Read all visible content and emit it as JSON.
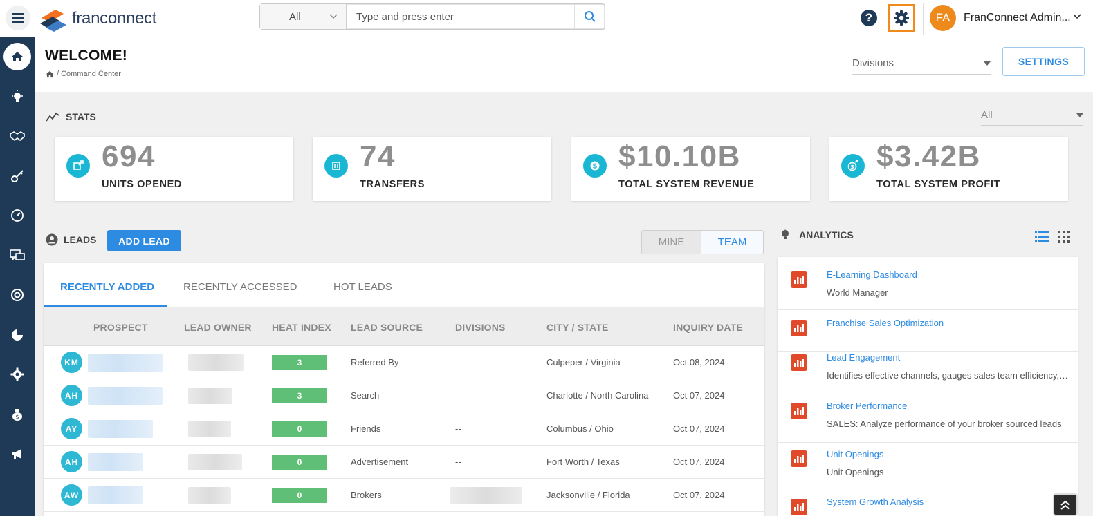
{
  "header": {
    "logo_text": "franconnect",
    "search_scope": "All",
    "search_placeholder": "Type and press enter",
    "user_initials": "FA",
    "user_name": "FranConnect Admin..."
  },
  "page": {
    "title": "WELCOME!",
    "breadcrumb": "/ Command Center",
    "divisions_label": "Divisions",
    "settings_label": "SETTINGS"
  },
  "stats": {
    "section_label": "STATS",
    "filter_value": "All",
    "cards": [
      {
        "value": "694",
        "label": "UNITS OPENED"
      },
      {
        "value": "74",
        "label": "TRANSFERS"
      },
      {
        "value": "$10.10B",
        "label": "TOTAL SYSTEM REVENUE"
      },
      {
        "value": "$3.42B",
        "label": "TOTAL SYSTEM PROFIT"
      }
    ]
  },
  "leads": {
    "section_label": "LEADS",
    "add_label": "ADD LEAD",
    "toggle_mine": "MINE",
    "toggle_team": "TEAM",
    "tabs": [
      "RECENTLY ADDED",
      "RECENTLY ACCESSED",
      "HOT LEADS"
    ],
    "columns": [
      "PROSPECT",
      "LEAD OWNER",
      "HEAT INDEX",
      "LEAD SOURCE",
      "DIVISIONS",
      "CITY / STATE",
      "INQUIRY DATE"
    ],
    "rows": [
      {
        "initials": "KM",
        "heat": "3",
        "source": "Referred By",
        "divisions": "--",
        "city": "Culpeper / Virginia",
        "date": "Oct 08, 2024"
      },
      {
        "initials": "AH",
        "heat": "3",
        "source": "Search",
        "divisions": "--",
        "city": "Charlotte / North Carolina",
        "date": "Oct 07, 2024"
      },
      {
        "initials": "AY",
        "heat": "0",
        "source": "Friends",
        "divisions": "--",
        "city": "Columbus / Ohio",
        "date": "Oct 07, 2024"
      },
      {
        "initials": "AH",
        "heat": "0",
        "source": "Advertisement",
        "divisions": "--",
        "city": "Fort Worth / Texas",
        "date": "Oct 07, 2024"
      },
      {
        "initials": "AW",
        "heat": "0",
        "source": "Brokers",
        "divisions": "",
        "city": "Jacksonville / Florida",
        "date": "Oct 07, 2024"
      }
    ]
  },
  "analytics": {
    "section_label": "ANALYTICS",
    "items": [
      {
        "title": "E-Learning Dashboard",
        "desc": "World Manager"
      },
      {
        "title": "Franchise Sales Optimization",
        "desc": ""
      },
      {
        "title": "Lead Engagement",
        "desc": "Identifies effective channels, gauges sales team efficiency, and optimizes strategies"
      },
      {
        "title": "Broker Performance",
        "desc": "SALES: Analyze performance of your broker sourced leads"
      },
      {
        "title": "Unit Openings",
        "desc": "Unit Openings"
      },
      {
        "title": "System Growth Analysis",
        "desc": ""
      }
    ]
  },
  "colors": {
    "sidebar": "#1f3a56",
    "accent": "#2e8be2",
    "stat_icon": "#19b7d4",
    "heat": "#5fbf77",
    "gear_highlight": "#f08a1c"
  }
}
